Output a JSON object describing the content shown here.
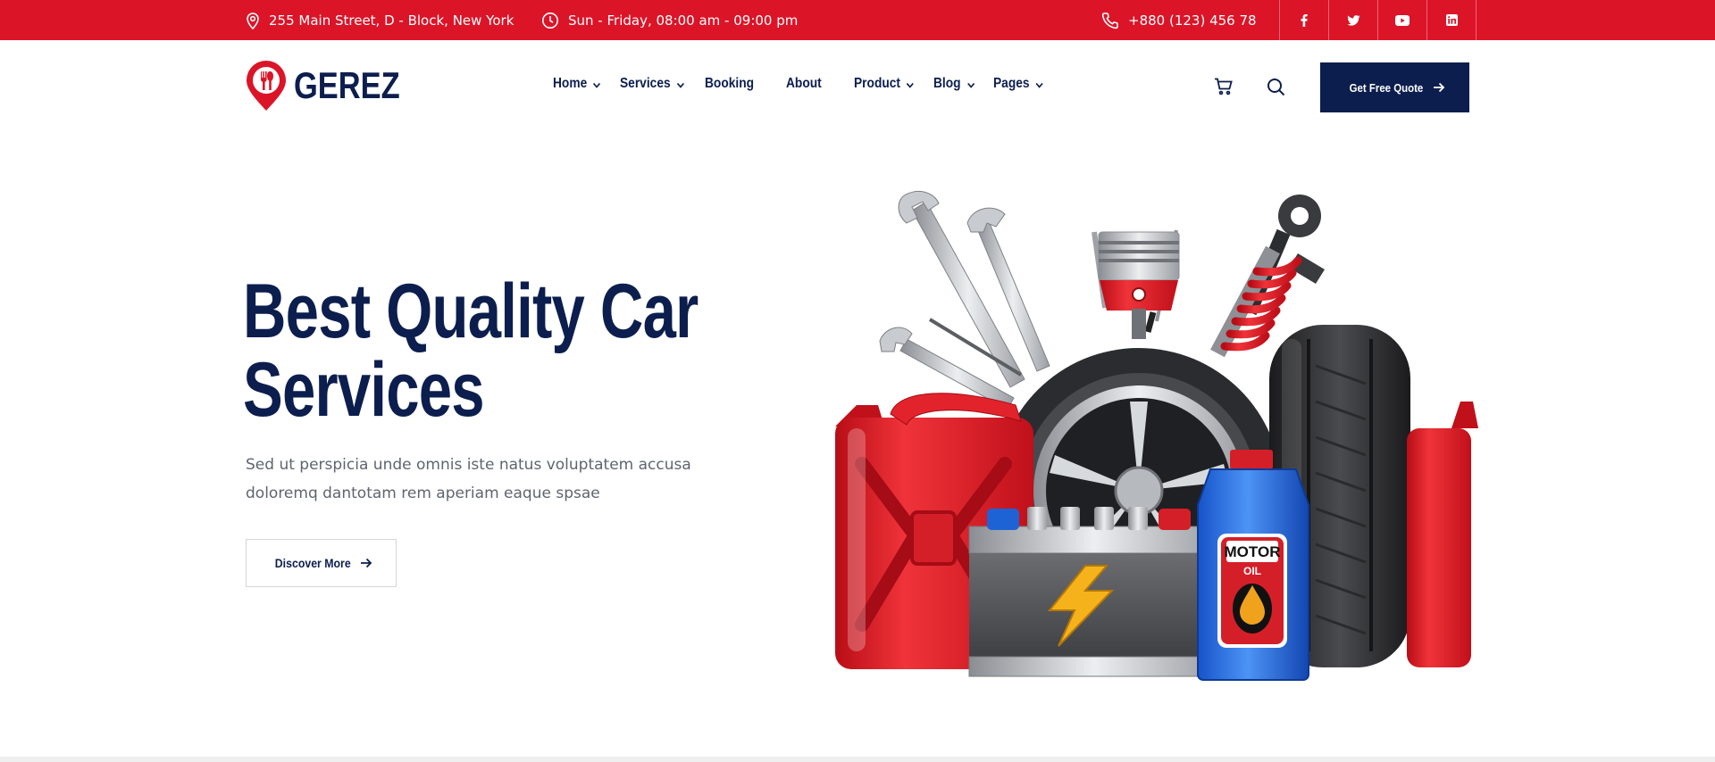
{
  "topbar": {
    "address": "255 Main Street, D - Block, New York",
    "hours": "Sun - Friday, 08:00 am - 09:00 pm",
    "phone": "+880 (123) 456 78",
    "social": [
      "facebook-icon",
      "twitter-icon",
      "youtube-icon",
      "linkedin-icon"
    ]
  },
  "header": {
    "logo_text": "GEREZ",
    "nav": [
      {
        "label": "Home",
        "dropdown": true
      },
      {
        "label": "Services",
        "dropdown": true
      },
      {
        "label": "Booking",
        "dropdown": false
      },
      {
        "label": "About",
        "dropdown": false
      },
      {
        "label": "Product",
        "dropdown": true
      },
      {
        "label": "Blog",
        "dropdown": true
      },
      {
        "label": "Pages",
        "dropdown": true
      }
    ],
    "icons": [
      "cart-icon",
      "search-icon"
    ],
    "cta_label": "Get Free Quote"
  },
  "hero": {
    "title_line1": "Best Quality Car",
    "title_line2": "Services",
    "subtitle_line1": "Sed ut perspicia unde omnis iste natus voluptatem accusa",
    "subtitle_line2": "doloremq dantotam rem aperiam eaque spsae",
    "button_label": "Discover More",
    "image_items": [
      "jerry-can",
      "wrench",
      "piston",
      "shock-absorber",
      "wheel",
      "tire",
      "car-battery",
      "motor-oil-bottle"
    ],
    "oil_label_1": "MOTOR",
    "oil_label_2": "OIL"
  },
  "colors": {
    "brand_red": "#dc1428",
    "navy": "#0c1e4e",
    "text_gray": "#5f6470"
  }
}
